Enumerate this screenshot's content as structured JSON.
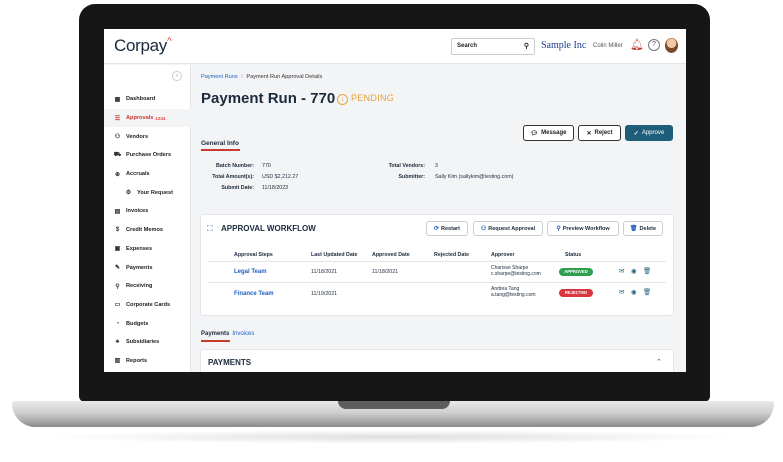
{
  "app": {
    "logo": "Corpay",
    "logo_mark": "^",
    "search_label": "Search",
    "company": "Sample Inc",
    "user_name": "Colin Miller"
  },
  "sidebar": {
    "items": [
      {
        "label": "Dashboard",
        "icon": "grid-icon",
        "glyph": "▦"
      },
      {
        "label": "Approvals",
        "badge": "1234",
        "icon": "checklist-icon",
        "glyph": "☰",
        "active": true
      },
      {
        "label": "Vendors",
        "icon": "people-icon",
        "glyph": "⚇"
      },
      {
        "label": "Purchase Orders",
        "icon": "cart-icon",
        "glyph": "⛟"
      },
      {
        "label": "Accruals",
        "icon": "globe-icon",
        "glyph": "⊕"
      },
      {
        "label": "Your Request",
        "icon": "gear-icon",
        "glyph": "⚙",
        "sub": true
      },
      {
        "label": "Invoices",
        "icon": "document-icon",
        "glyph": "▤"
      },
      {
        "label": "Credit Memos",
        "icon": "dollar-icon",
        "glyph": "$"
      },
      {
        "label": "Expenses",
        "icon": "receipt-icon",
        "glyph": "▣"
      },
      {
        "label": "Payments",
        "icon": "pay-icon",
        "glyph": "✎"
      },
      {
        "label": "Receiving",
        "icon": "receive-icon",
        "glyph": "⚲"
      },
      {
        "label": "Corporate Cards",
        "icon": "card-icon",
        "glyph": "▭"
      },
      {
        "label": "Budgets",
        "icon": "chart-icon",
        "glyph": "◔"
      },
      {
        "label": "Subsidiaries",
        "icon": "org-icon",
        "glyph": "♣"
      },
      {
        "label": "Reports",
        "icon": "report-icon",
        "glyph": "▥"
      }
    ]
  },
  "page": {
    "breadcrumb_root": "Payment Runs",
    "breadcrumb_sep": "/",
    "breadcrumb_current": "Payment Run Approval Details",
    "title": "Payment Run - 770",
    "status": "PENDING",
    "buttons": {
      "message": "Message",
      "reject": "Reject",
      "approve": "Approve"
    }
  },
  "general_info": {
    "tab": "General Info",
    "fields": [
      {
        "label": "Batch Number:",
        "value": "770"
      },
      {
        "label": "Total Amount(s):",
        "value": "USD $2,212.27"
      },
      {
        "label": "Submit Date:",
        "value": "11/18/2023"
      },
      {
        "label": "Total Vendors:",
        "value": "3"
      },
      {
        "label": "Submitter:",
        "value": "Sally Kim (sallykim@testing.com)"
      }
    ]
  },
  "workflow": {
    "title": "APPROVAL WORKFLOW",
    "buttons": {
      "restart": "Restart",
      "request": "Request Approval",
      "preview": "Preview Workflow",
      "delete": "Delete"
    },
    "columns": [
      "Approval Steps",
      "Last Updated Date",
      "Approved Date",
      "Rejected Date",
      "Approver",
      "Status"
    ],
    "rows": [
      {
        "step": "Legal Team",
        "last_updated": "11/18/2021",
        "approved": "11/18/2021",
        "rejected": "",
        "approver_name": "Charisse Sharpe",
        "approver_email": "c.sharpe@testing.com",
        "status": "APPROVED",
        "status_color": "#2e9e4f"
      },
      {
        "step": "Finance Team",
        "last_updated": "11/19/2021",
        "approved": "",
        "rejected": "",
        "approver_name": "Andrea Tang",
        "approver_email": "a.tang@testing.com",
        "status": "REJECTED",
        "status_color": "#d9363e"
      }
    ]
  },
  "lower_tabs": {
    "payments": "Payments",
    "invoices": "Invoices"
  },
  "payments_section": {
    "title": "PAYMENTS"
  },
  "colors": {
    "accent": "#c8392e",
    "primary": "#1e5e7a",
    "link": "#1f5fbf",
    "pending": "#e6a23c"
  }
}
